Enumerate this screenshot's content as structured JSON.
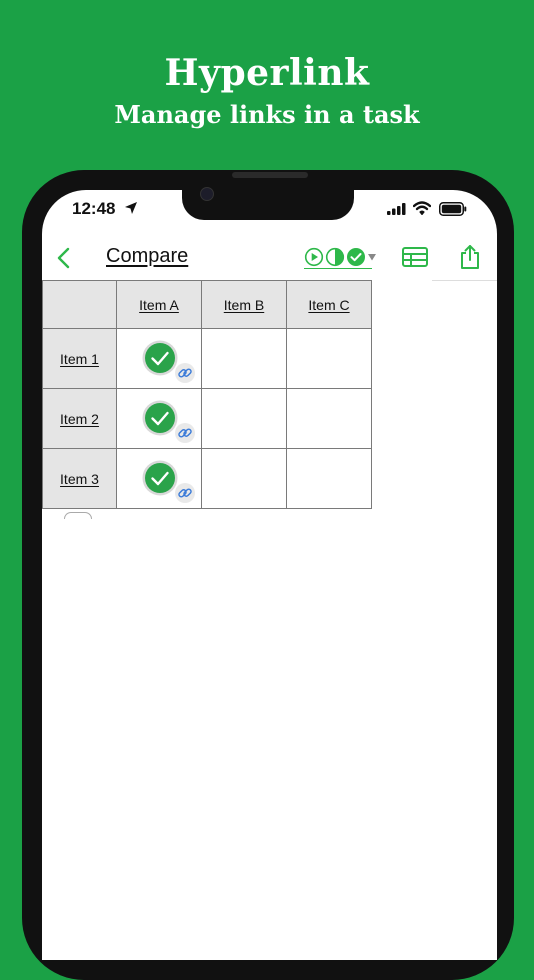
{
  "promo": {
    "title": "Hyperlink",
    "subtitle": "Manage links in a task"
  },
  "status_bar": {
    "time": "12:48"
  },
  "nav": {
    "title": "Compare",
    "icons": [
      "chevron-left-icon",
      "play-circle-icon",
      "half-circle-icon",
      "check-circle-icon",
      "caret-down-icon",
      "table-icon",
      "share-icon"
    ]
  },
  "table": {
    "columns": [
      "Item A",
      "Item B",
      "Item C"
    ],
    "rows": [
      {
        "label": "Item 1",
        "cells": [
          {
            "checked": true,
            "linked": true
          },
          {
            "checked": false,
            "linked": false
          },
          {
            "checked": false,
            "linked": false
          }
        ]
      },
      {
        "label": "Item 2",
        "cells": [
          {
            "checked": true,
            "linked": true
          },
          {
            "checked": false,
            "linked": false
          },
          {
            "checked": false,
            "linked": false
          }
        ]
      },
      {
        "label": "Item 3",
        "cells": [
          {
            "checked": true,
            "linked": true
          },
          {
            "checked": false,
            "linked": false
          },
          {
            "checked": false,
            "linked": false
          }
        ]
      }
    ]
  },
  "colors": {
    "background": "#1ba146",
    "accent": "#2eb84a",
    "check": "#2aa34a",
    "link": "#3b7bd8",
    "header_fill": "#e5e5e5"
  }
}
